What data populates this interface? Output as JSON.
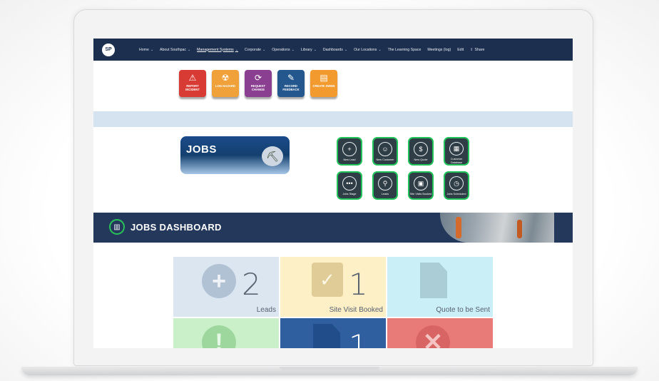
{
  "nav": {
    "logo": "SP",
    "items": [
      {
        "label": "Home",
        "dropdown": true
      },
      {
        "label": "About Southpac",
        "dropdown": true
      },
      {
        "label": "Management Systems",
        "dropdown": true,
        "active": true
      },
      {
        "label": "Corporate",
        "dropdown": true
      },
      {
        "label": "Operations",
        "dropdown": true
      },
      {
        "label": "Library",
        "dropdown": true
      },
      {
        "label": "Dashboards",
        "dropdown": true
      },
      {
        "label": "Our Locations",
        "dropdown": true
      },
      {
        "label": "The Learning Space",
        "dropdown": false
      },
      {
        "label": "Meetings (log)",
        "dropdown": false
      }
    ],
    "edit": "Edit",
    "share": "Share"
  },
  "actions": [
    {
      "label": "REPORT INCIDENT",
      "color": "#d83a34",
      "icon": "warning-icon"
    },
    {
      "label": "LOG HAZARD",
      "color": "#f0a13a",
      "icon": "hazard-icon"
    },
    {
      "label": "REQUEST CHANGE",
      "color": "#8a3f91",
      "icon": "refresh-icon"
    },
    {
      "label": "RECORD FEEDBACK",
      "color": "#23578e",
      "icon": "feedback-icon"
    },
    {
      "label": "CREATE SWMS",
      "color": "#f29a2e",
      "icon": "document-icon"
    }
  ],
  "jobs_banner": {
    "title": "JOBS"
  },
  "tiles": [
    {
      "label": "New Lead",
      "icon": "lead-icon"
    },
    {
      "label": "New Customer",
      "icon": "customer-icon"
    },
    {
      "label": "New Quote",
      "icon": "quote-icon"
    },
    {
      "label": "Customer Database",
      "icon": "database-icon"
    },
    {
      "label": "Jobs Stage",
      "icon": "stage-icon"
    },
    {
      "label": "Leads",
      "icon": "leads-icon"
    },
    {
      "label": "Site Visits Booked",
      "icon": "calendar-icon"
    },
    {
      "label": "Jobs Scheduled",
      "icon": "scheduled-icon"
    }
  ],
  "dashboard": {
    "title": "JOBS DASHBOARD"
  },
  "stats": [
    {
      "value": "2",
      "label": "Leads",
      "bg": "#dce6f1",
      "icon": "plus-icon",
      "accent": "#8fa6bd"
    },
    {
      "value": "1",
      "label": "Site Visit Booked",
      "bg": "#fdf0c7",
      "icon": "calendar-check-icon",
      "accent": "#c9b070"
    },
    {
      "value": "",
      "label": "Quote to be Sent",
      "bg": "#cbeff7",
      "icon": "document-icon",
      "accent": "#8fb0bb"
    },
    {
      "value": "",
      "label": "",
      "bg": "#c9f0c9",
      "icon": "alert-icon",
      "accent": "#7cc37c"
    },
    {
      "value": "1",
      "label": "",
      "bg": "#2f5f9f",
      "icon": "file-icon",
      "accent": "#1e4a84"
    },
    {
      "value": "",
      "label": "",
      "bg": "#e87a78",
      "icon": "cancel-icon",
      "accent": "#c55"
    }
  ]
}
